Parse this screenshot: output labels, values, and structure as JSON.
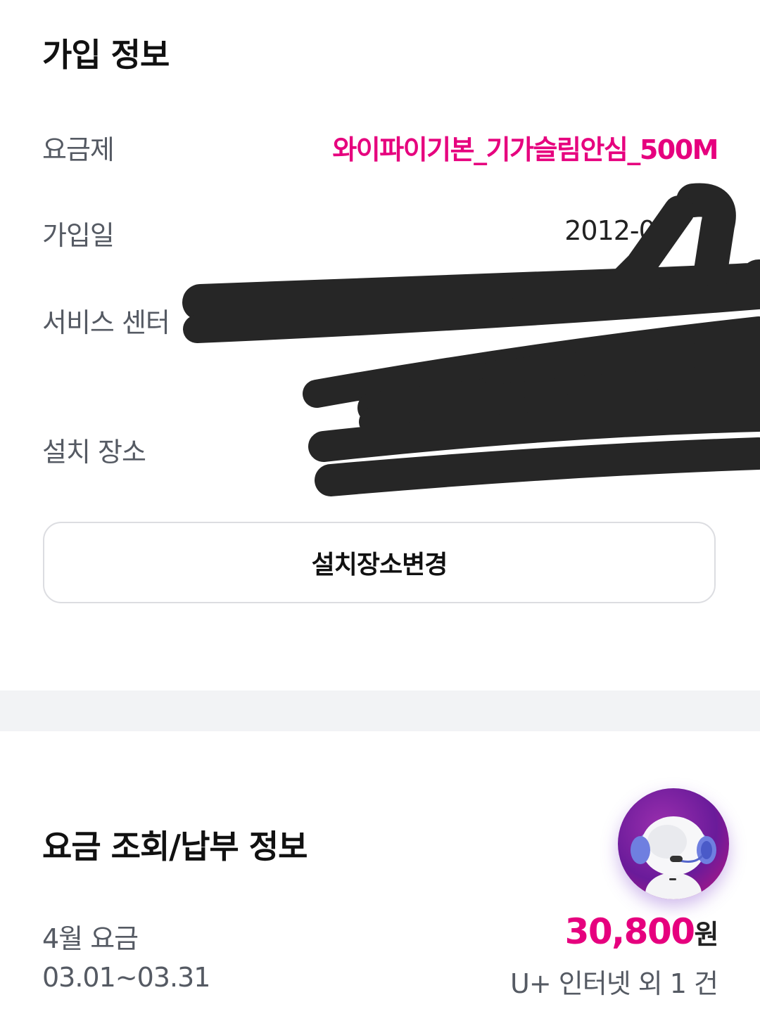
{
  "join_info": {
    "title": "가입 정보",
    "plan_label": "요금제",
    "plan_value": "와이파이기본_기가슬림안심_500M",
    "join_date_label": "가입일",
    "join_date_value": "2012-07",
    "service_center_label": "서비스 센터",
    "install_location_label": "설치 장소",
    "change_location_button": "설치장소변경"
  },
  "billing": {
    "title": "요금 조회/납부 정보",
    "month_label": "4월 요금",
    "period": "03.01~03.31",
    "amount": "30,800",
    "currency_unit": "원",
    "services_summary": "U+ 인터넷 외 1 건"
  },
  "colors": {
    "accent": "#e6007e",
    "label": "#555a63",
    "divider": "#f2f3f5",
    "redaction": "#262626"
  },
  "icons": {
    "chatbot_avatar": "chatbot-astronaut-icon"
  }
}
